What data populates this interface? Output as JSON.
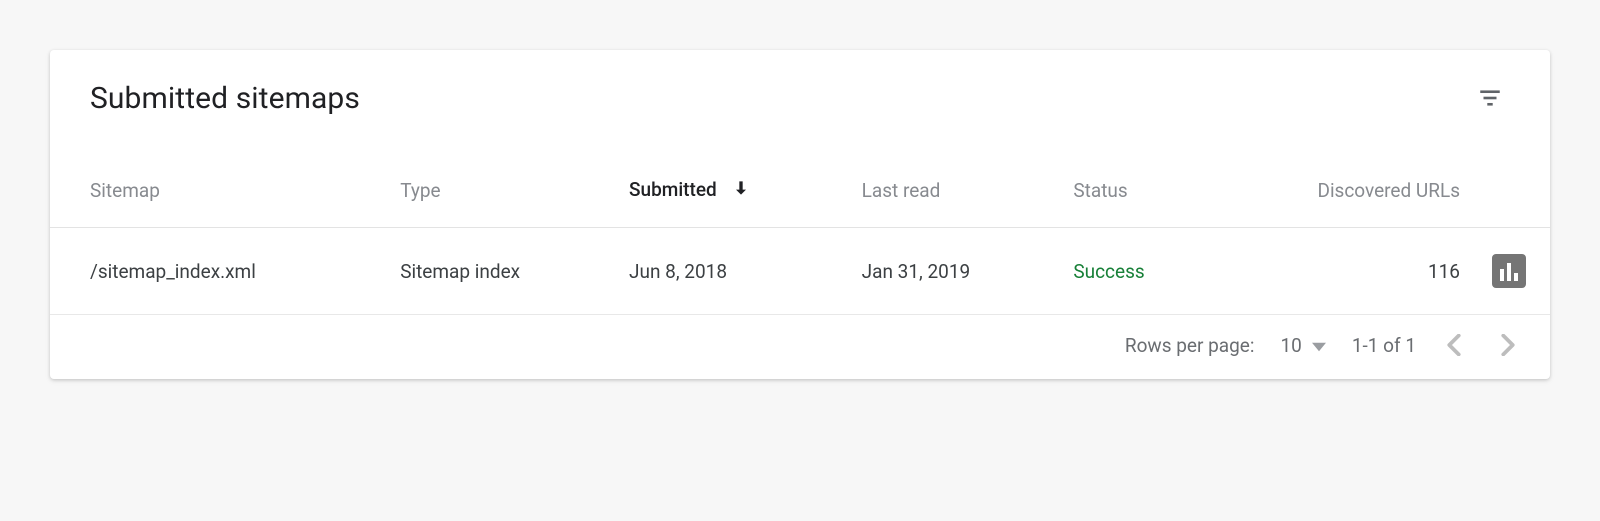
{
  "card": {
    "title": "Submitted sitemaps"
  },
  "table": {
    "columns": {
      "sitemap": "Sitemap",
      "type": "Type",
      "submitted": "Submitted",
      "last_read": "Last read",
      "status": "Status",
      "discovered": "Discovered URLs"
    },
    "rows": [
      {
        "sitemap": "/sitemap_index.xml",
        "type": "Sitemap index",
        "submitted": "Jun 8, 2018",
        "last_read": "Jan 31, 2019",
        "status": "Success",
        "discovered": "116"
      }
    ]
  },
  "pagination": {
    "rows_label": "Rows per page:",
    "rows_value": "10",
    "range": "1-1 of 1"
  }
}
